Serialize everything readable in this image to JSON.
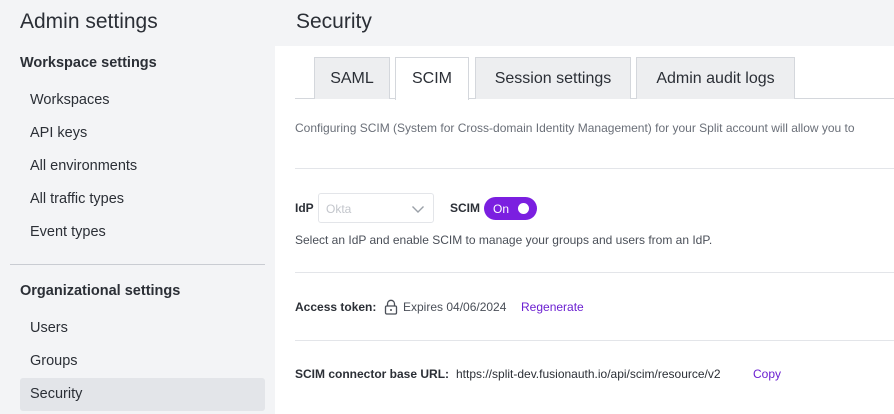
{
  "sidebar": {
    "title": "Admin settings",
    "workspace_heading": "Workspace settings",
    "workspace_items": [
      "Workspaces",
      "API keys",
      "All environments",
      "All traffic types",
      "Event types"
    ],
    "org_heading": "Organizational settings",
    "org_items": [
      "Users",
      "Groups",
      "Security"
    ],
    "active_item": "Security"
  },
  "header": {
    "title": "Security"
  },
  "tabs": [
    {
      "label": "SAML"
    },
    {
      "label": "SCIM"
    },
    {
      "label": "Session settings"
    },
    {
      "label": "Admin audit logs"
    }
  ],
  "active_tab": "SCIM",
  "scim": {
    "intro": "Configuring SCIM (System for Cross-domain Identity Management) for your Split account will allow you to",
    "idp_label": "IdP",
    "idp_value": "Okta",
    "scim_label": "SCIM",
    "toggle_label": "On",
    "toggle_on": true,
    "help_text": "Select an IdP and enable SCIM to manage your groups and users from an IdP.",
    "access_token_label": "Access token:",
    "expires_text": "Expires 04/06/2024",
    "regenerate_label": "Regenerate",
    "base_url_label": "SCIM connector base URL:",
    "base_url": "https://split-dev.fusionauth.io/api/scim/resource/v2",
    "copy_label": "Copy"
  },
  "colors": {
    "accent": "#7b1fe0",
    "link": "#6b1fd1",
    "sidebar_bg": "#f3f4f6"
  },
  "icons": {
    "chevron": "chevron-down-icon",
    "lock": "lock-icon"
  }
}
